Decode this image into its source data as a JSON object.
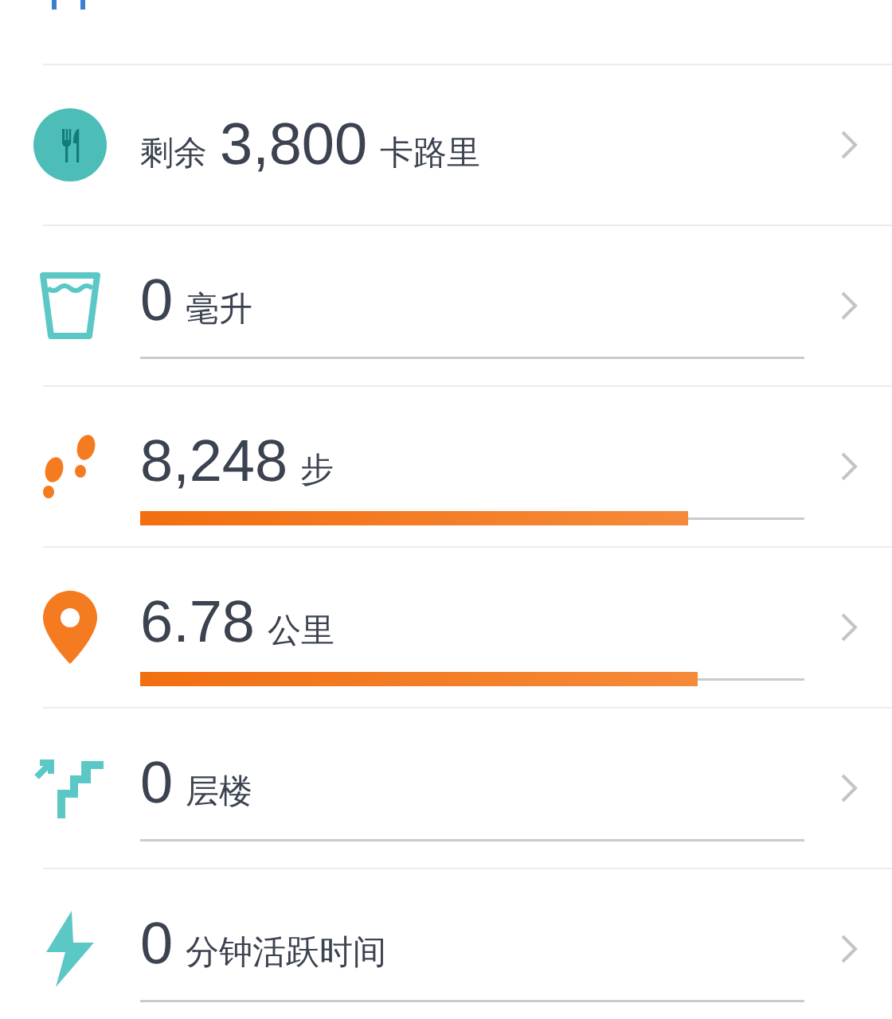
{
  "rows": [
    {
      "prefix": "剩余",
      "value": "3,800",
      "unit": "卡路里"
    },
    {
      "prefix": "",
      "value": "0",
      "unit": "毫升",
      "track": true
    },
    {
      "prefix": "",
      "value": "8,248",
      "unit": "步",
      "level": 0.825
    },
    {
      "prefix": "",
      "value": "6.78",
      "unit": "公里",
      "level": 0.84
    },
    {
      "prefix": "",
      "value": "0",
      "unit": "层楼",
      "track": true
    },
    {
      "prefix": "",
      "value": "0",
      "unit": "分钟活跃时间",
      "track": true
    }
  ]
}
